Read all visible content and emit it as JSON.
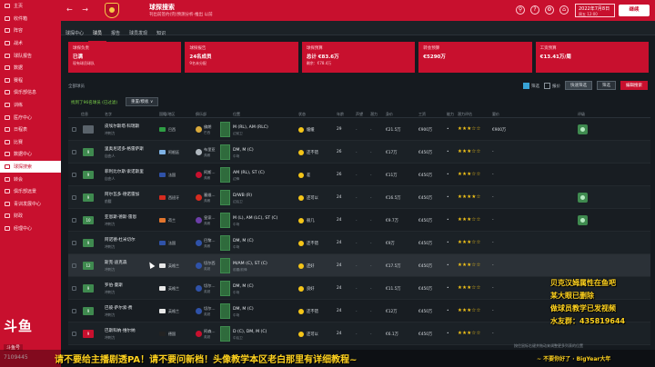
{
  "sidebar": {
    "items": [
      {
        "label": "主页",
        "active": false
      },
      {
        "label": "收件箱",
        "active": false
      },
      {
        "label": "阵容",
        "active": false
      },
      {
        "label": "战术",
        "active": false
      },
      {
        "label": "球队报告",
        "active": false
      },
      {
        "label": "数据",
        "active": false
      },
      {
        "label": "赛程",
        "active": false
      },
      {
        "label": "俱乐部信息",
        "active": false
      },
      {
        "label": "训练",
        "active": false
      },
      {
        "label": "医疗中心",
        "active": false
      },
      {
        "label": "日程表",
        "active": false
      },
      {
        "label": "比赛",
        "active": false
      },
      {
        "label": "数据中心",
        "active": false
      },
      {
        "label": "球探搜索",
        "active": true
      },
      {
        "label": "转会",
        "active": false
      },
      {
        "label": "俱乐部远景",
        "active": false
      },
      {
        "label": "青训发展中心",
        "active": false
      },
      {
        "label": "财政",
        "active": false
      },
      {
        "label": "经理中心",
        "active": false
      }
    ],
    "brand": "斗鱼",
    "brand_sub": "斗鱼号",
    "room": "7109445"
  },
  "header": {
    "nav_back": "←",
    "nav_forward": "→",
    "title": "球探搜索",
    "subtitle": "刊出前签约(完)预测分析-推出 以前",
    "icons": [
      "search-icon",
      "help-icon",
      "settings-icon",
      "home-icon"
    ],
    "icon_glyphs": [
      "⚲",
      "?",
      "⚙",
      "⌂"
    ],
    "date_line1": "2022年7月8日",
    "date_line2": "周五 12:00",
    "continue_label": "继续"
  },
  "tabs": [
    "球探中心",
    "球员",
    "报告",
    "球员发现",
    "知识"
  ],
  "active_tab": 1,
  "cards": [
    {
      "title": "球探负责",
      "value": "已满",
      "sub": "现有球员球队"
    },
    {
      "title": "球探报告",
      "value": "24名成员",
      "sub": "9名未分配"
    },
    {
      "title": "球探预算",
      "value": "总计 €83.6万",
      "sub": "剩余：€78.4万"
    },
    {
      "title": "转会预算",
      "value": "€5290万",
      "sub": ""
    },
    {
      "title": "工资预算",
      "value": "€13.41万/周",
      "sub": ""
    }
  ],
  "filters": {
    "left_label": "全部球员",
    "opt1": "筛选",
    "opt2": "报价",
    "btn_preset": "快速筛选",
    "btn_filter": "筛选",
    "btn_edit": "编辑搜索"
  },
  "subrow": {
    "count": "找到了96名球员 (已过滤)",
    "select": "重置/模板 ∨"
  },
  "columns": [
    "信息",
    "名字",
    "国籍/地区",
    "俱乐部",
    "位置",
    "状态",
    "年龄",
    "声望",
    "潜力",
    "身价",
    "工资",
    "能力",
    "潜力评估",
    "要价",
    "评级"
  ],
  "rows": [
    {
      "badge": "",
      "badge_color": "#5a636b",
      "name": "皮埃尔斯塔·科瑞斯",
      "sub": "冲刺力",
      "nation": "巴西",
      "flag": "#2e9e44",
      "club": "佛朗",
      "club2": "巴西",
      "club_color": "#d9a93b",
      "pos": "M (RL), AM (RLC)",
      "pos2": "边前卫",
      "status": "缓缓",
      "age": "29",
      "value": "€21.5万",
      "wage": "€900万",
      "stars": "★★★☆☆",
      "ask": "€900万",
      "rated": true
    },
    {
      "badge": "9",
      "badge_color": "#3f8a4f",
      "name": "里奥尼诺多·格雷萨斯",
      "sub": "自由人",
      "nation": "阿根廷",
      "flag": "#7fb3e6",
      "club": "布里亚",
      "club2": "弗朗",
      "club_color": "#b0b8bf",
      "pos": "DM, M (C)",
      "pos2": "中场",
      "status": "还不错",
      "age": "26",
      "value": "€17万",
      "wage": "€450万",
      "stars": "★★★☆☆",
      "ask": "-",
      "rated": false
    },
    {
      "badge": "9",
      "badge_color": "#3f8a4f",
      "name": "菲利比尔斯·索诺斯里",
      "sub": "自由人",
      "nation": "法国",
      "flag": "#2f52a8",
      "club": "阿斯…",
      "club2": "弗朗",
      "club_color": "#c8102e",
      "pos": "AM (RL), ST (C)",
      "pos2": "边锋",
      "status": "差",
      "age": "26",
      "value": "€11万",
      "wage": "€450万",
      "stars": "★★★☆☆",
      "ask": "-",
      "rated": false
    },
    {
      "badge": "9",
      "badge_color": "#3f8a4f",
      "name": "阿尔瓦多·德诺雷加",
      "sub": "前腰",
      "nation": "西班牙",
      "flag": "#d62b1f",
      "club": "塞维…",
      "club2": "弗朗",
      "club_color": "#d62b1f",
      "pos": "D/WB (R)",
      "pos2": "边后卫",
      "status": "还可以",
      "age": "24",
      "value": "€16.5万",
      "wage": "€450万",
      "stars": "★★★★☆",
      "ask": "-",
      "rated": true
    },
    {
      "badge": "10",
      "badge_color": "#3f8a4f",
      "name": "亚恩斯·德斯·雷恩",
      "sub": "冲刺力",
      "nation": "荷兰",
      "flag": "#e3752d",
      "club": "皇家…",
      "club2": "弗朗",
      "club_color": "#6c3ea8",
      "pos": "M (L), AM (LC), ST (C)",
      "pos2": "中场",
      "status": "很几",
      "age": "24",
      "value": "€9.7万",
      "wage": "€450万",
      "stars": "★★★☆☆",
      "ask": "-",
      "rated": true
    },
    {
      "badge": "9",
      "badge_color": "#3f8a4f",
      "name": "阿诺德·杜米切尔",
      "sub": "冲刺力",
      "nation": "法国",
      "flag": "#2f52a8",
      "club": "巴黎…",
      "club2": "弗朗",
      "club_color": "#2f52a8",
      "pos": "DM, M (C)",
      "pos2": "中场",
      "status": "还不错",
      "age": "24",
      "value": "€9万",
      "wage": "€450万",
      "stars": "★★★☆☆",
      "ask": "-",
      "rated": false
    },
    {
      "badge": "12",
      "badge_color": "#3f8a4f",
      "name": "斯克·迪克森",
      "sub": "冲刺力",
      "nation": "英格兰",
      "flag": "#e8e8e8",
      "club": "切尔西",
      "club2": "英超",
      "club_color": "#2f52a8",
      "pos": "M/AM (C), ST (C)",
      "pos2": "前腰/前锋",
      "status": "还好",
      "age": "24",
      "value": "€17.5万",
      "wage": "€450万",
      "stars": "★★★☆☆",
      "ask": "-",
      "rated": false,
      "highlight": true
    },
    {
      "badge": "9",
      "badge_color": "#3f8a4f",
      "name": "罗伯·曼斯",
      "sub": "冲刺力",
      "nation": "英格兰",
      "flag": "#e8e8e8",
      "club": "切尔…",
      "club2": "英超",
      "club_color": "#2f52a8",
      "pos": "DM, M (C)",
      "pos2": "中场",
      "status": "良好",
      "age": "24",
      "value": "€11.5万",
      "wage": "€450万",
      "stars": "★★★☆☆",
      "ask": "-",
      "rated": false
    },
    {
      "badge": "9",
      "badge_color": "#3f8a4f",
      "name": "巴彼·萨尔索·费",
      "sub": "冲刺力",
      "nation": "英格兰",
      "flag": "#e8e8e8",
      "club": "切尔…",
      "club2": "英超",
      "club_color": "#2f52a8",
      "pos": "DM, M (C)",
      "pos2": "中场",
      "status": "还不错",
      "age": "24",
      "value": "€12万",
      "wage": "€450万",
      "stars": "★★★☆☆",
      "ask": "-",
      "rated": false
    },
    {
      "badge": "9",
      "badge_color": "#c8102e",
      "name": "巴斯科纳·维尔纳",
      "sub": "冲刺力",
      "nation": "德国",
      "flag": "#222222",
      "club": "阿森…",
      "club2": "英超",
      "club_color": "#c8102e",
      "pos": "D (C), DM, M (C)",
      "pos2": "中后卫",
      "status": "还可以",
      "age": "24",
      "value": "€6.1万",
      "wage": "€450万",
      "stars": "★★★☆☆",
      "ask": "-",
      "rated": false
    }
  ],
  "overlay": {
    "right_lines": [
      "贝克汉姆属性在鱼吧",
      "某大眼已删除",
      "做球员教学已发视频",
      "水友群：435819644"
    ],
    "ticker": "请不要给主播剧透PA！请不要问新档！头像教学本区老白那里有详细教程~",
    "ticker_right": "~ 不要你好了 · BigYear大年",
    "hint": "按住鼠标右键并拖动来调整更多列表的位置"
  }
}
